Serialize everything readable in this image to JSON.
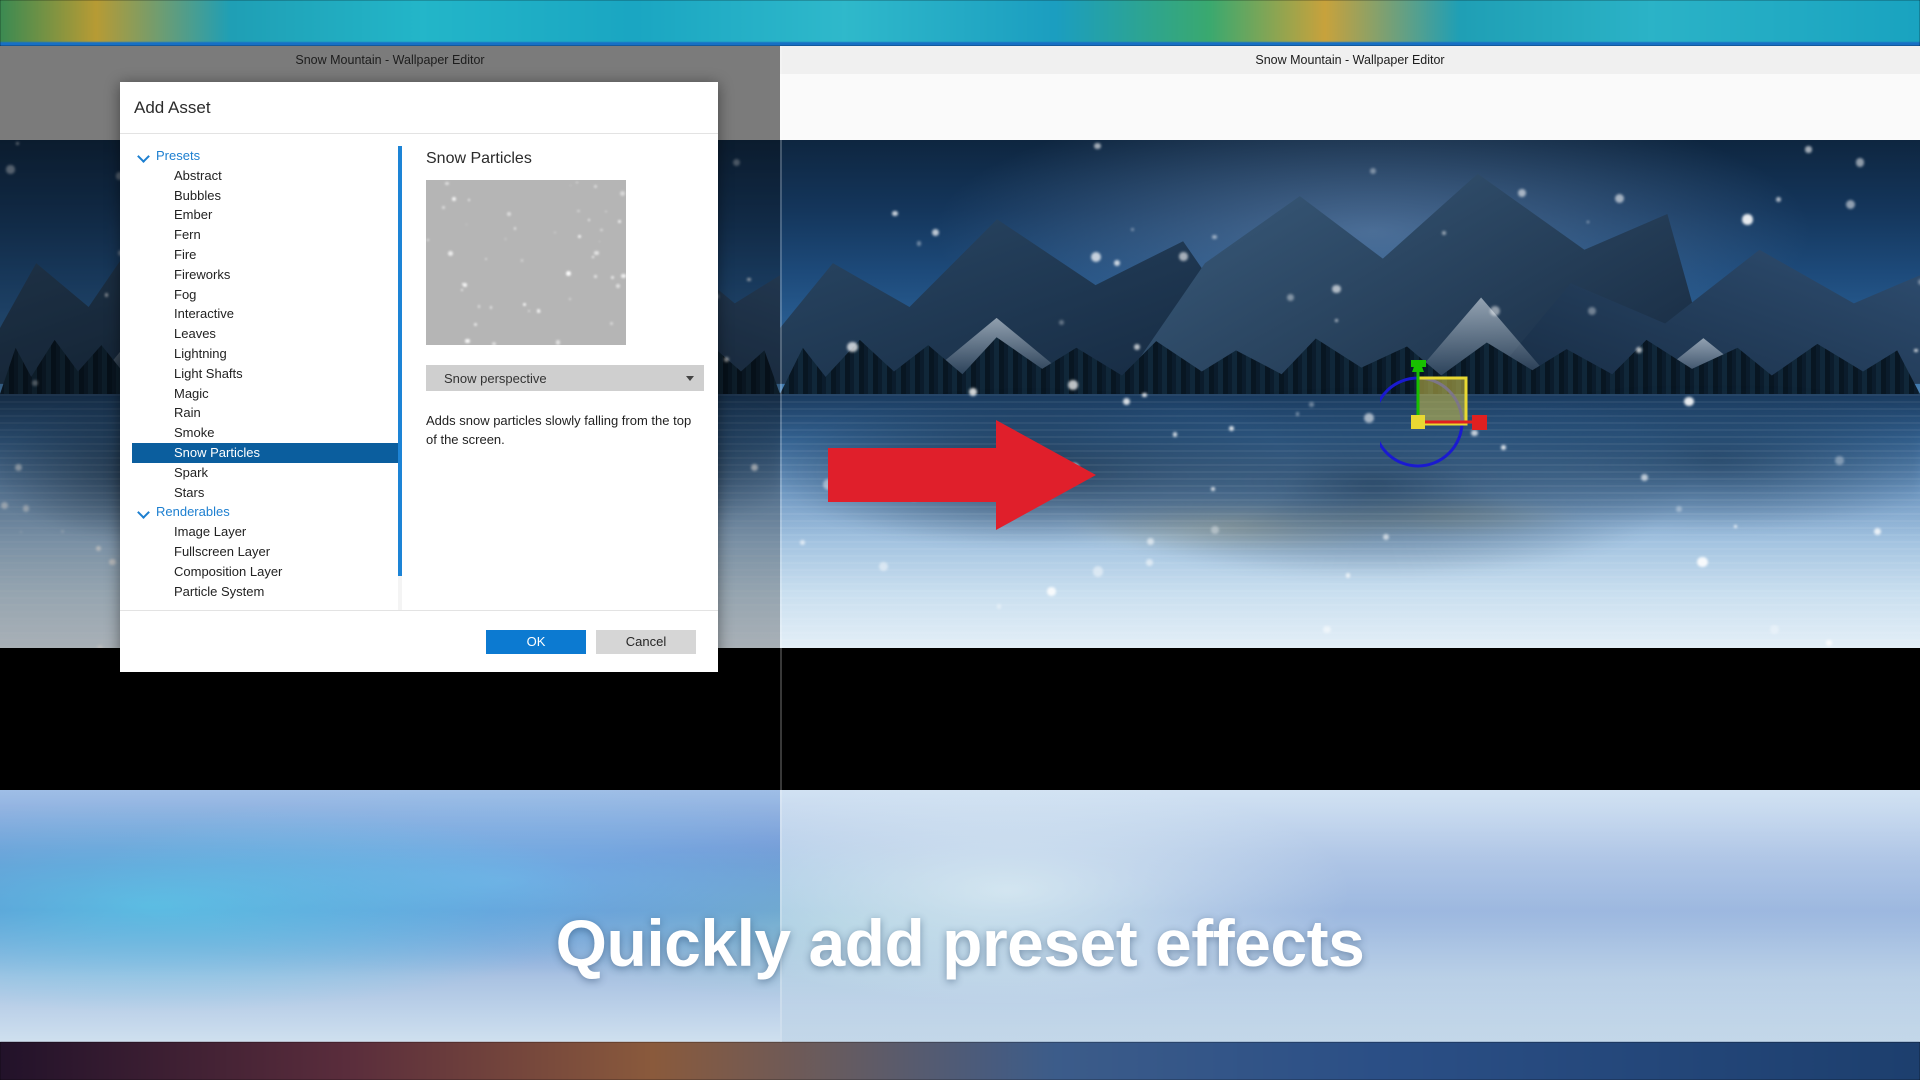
{
  "window": {
    "left_title": "Snow Mountain - Wallpaper Editor",
    "right_title": "Snow Mountain - Wallpaper Editor"
  },
  "caption": "Quickly add preset effects",
  "dialog": {
    "title": "Add Asset",
    "tree": [
      {
        "type": "group",
        "label": "Presets"
      },
      {
        "type": "item",
        "label": "Abstract"
      },
      {
        "type": "item",
        "label": "Bubbles"
      },
      {
        "type": "item",
        "label": "Ember"
      },
      {
        "type": "item",
        "label": "Fern"
      },
      {
        "type": "item",
        "label": "Fire"
      },
      {
        "type": "item",
        "label": "Fireworks"
      },
      {
        "type": "item",
        "label": "Fog"
      },
      {
        "type": "item",
        "label": "Interactive"
      },
      {
        "type": "item",
        "label": "Leaves"
      },
      {
        "type": "item",
        "label": "Lightning"
      },
      {
        "type": "item",
        "label": "Light Shafts"
      },
      {
        "type": "item",
        "label": "Magic"
      },
      {
        "type": "item",
        "label": "Rain"
      },
      {
        "type": "item",
        "label": "Smoke"
      },
      {
        "type": "item",
        "label": "Snow Particles",
        "selected": true
      },
      {
        "type": "item",
        "label": "Spark"
      },
      {
        "type": "item",
        "label": "Stars"
      },
      {
        "type": "group",
        "label": "Renderables"
      },
      {
        "type": "item",
        "label": "Image Layer"
      },
      {
        "type": "item",
        "label": "Fullscreen Layer"
      },
      {
        "type": "item",
        "label": "Composition Layer"
      },
      {
        "type": "item",
        "label": "Particle System"
      }
    ],
    "detail": {
      "title": "Snow Particles",
      "preview_icon": "snow-particles-preview",
      "variant_selected": "Snow perspective",
      "description": "Adds snow particles slowly falling from the top of the screen."
    },
    "buttons": {
      "ok": "OK",
      "cancel": "Cancel"
    }
  },
  "colors": {
    "accent": "#0c7ad1",
    "selection": "#0b5e9e",
    "group_link": "#1d7fd0",
    "arrow": "#e01f2b",
    "gizmo_x": "#e02020",
    "gizmo_y": "#18c000",
    "gizmo_circle": "#1a1ad0"
  },
  "annotations": {
    "arrow_icon": "right-arrow-annotation",
    "gizmo_icon": "transform-gizmo"
  }
}
